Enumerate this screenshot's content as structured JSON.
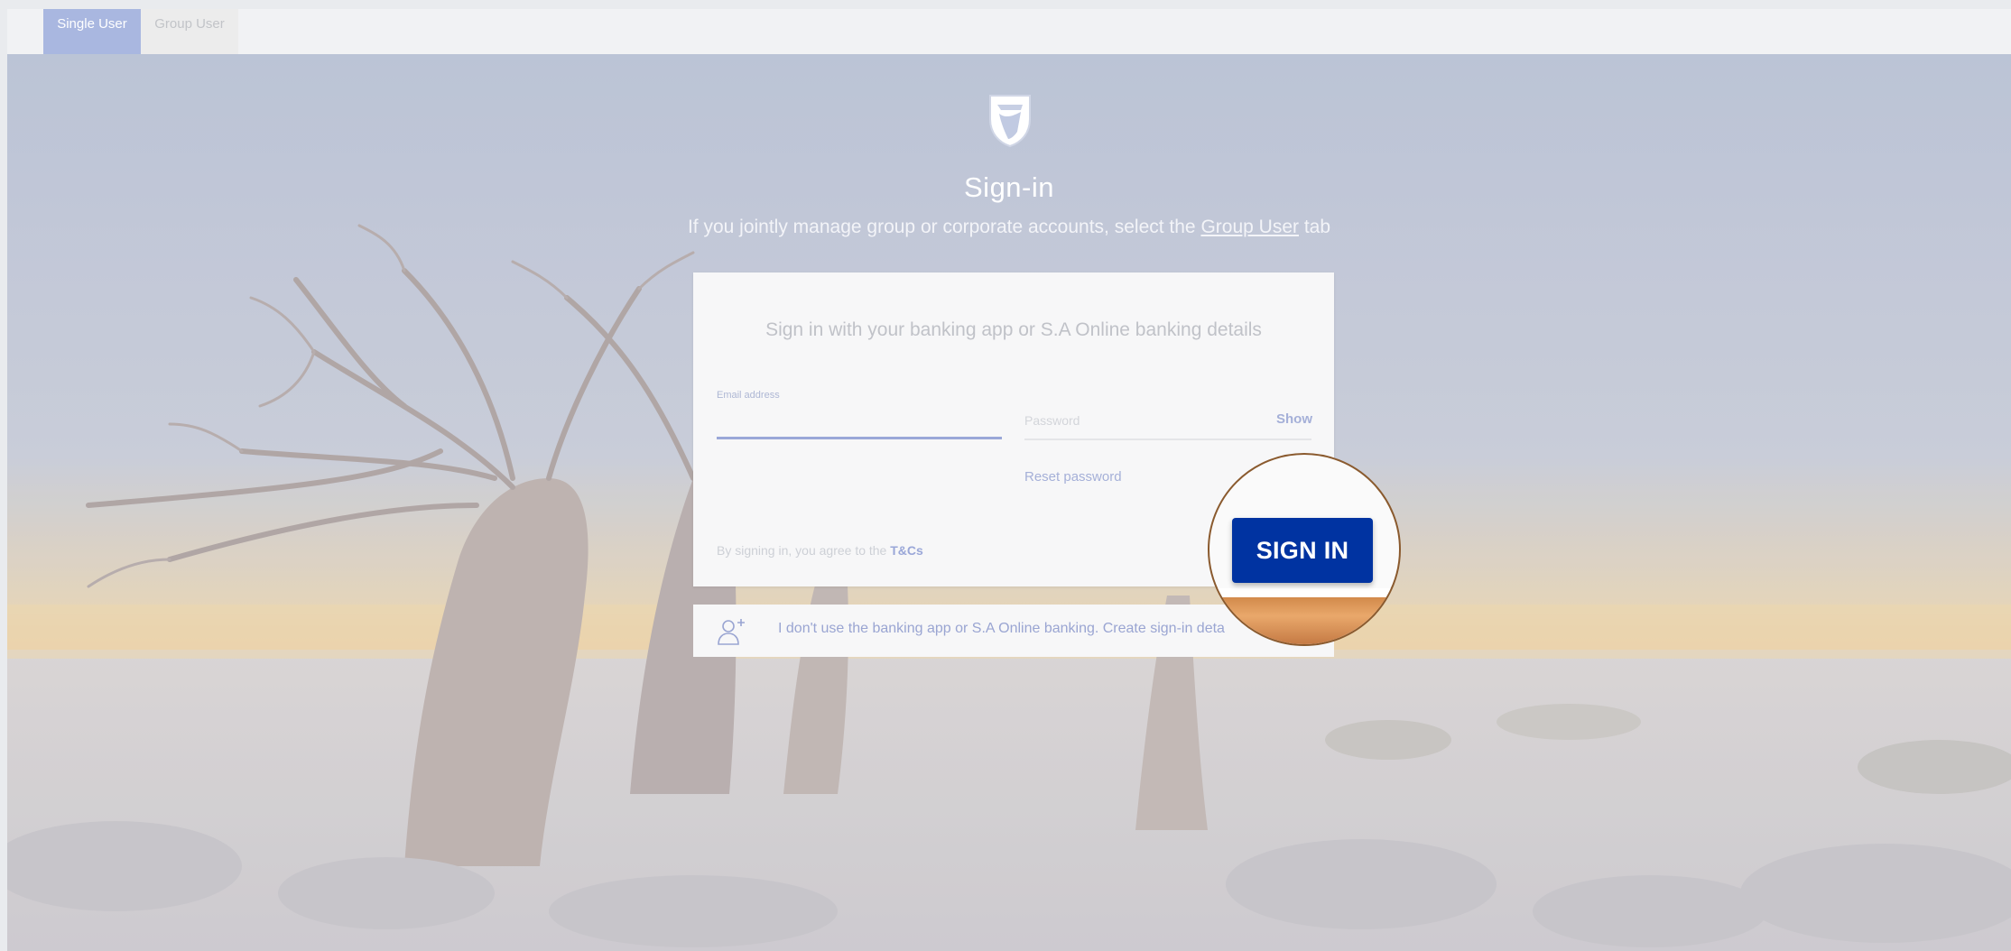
{
  "tabs": [
    {
      "label": "Single User",
      "active": true
    },
    {
      "label": "Group User",
      "active": false
    }
  ],
  "header": {
    "logo_icon": "shield-flag-logo",
    "title": "Sign-in",
    "subtitle_pre": "If you jointly manage group or corporate accounts, select the ",
    "subtitle_link": "Group User",
    "subtitle_post": " tab"
  },
  "card": {
    "heading": "Sign in with your banking app or S.A Online banking details",
    "email_label": "Email address",
    "password_placeholder": "Password",
    "show_label": "Show",
    "reset_label": "Reset password",
    "terms_pre": "By signing in, you agree to the ",
    "terms_link": "T&Cs",
    "signin_label": "SIGN IN"
  },
  "create": {
    "icon": "add-user-icon",
    "text": "I don't use the banking app or S.A Online banking. Create sign-in deta"
  },
  "colors": {
    "primary": "#0033a1",
    "highlight_ring": "#8a5a2e"
  }
}
